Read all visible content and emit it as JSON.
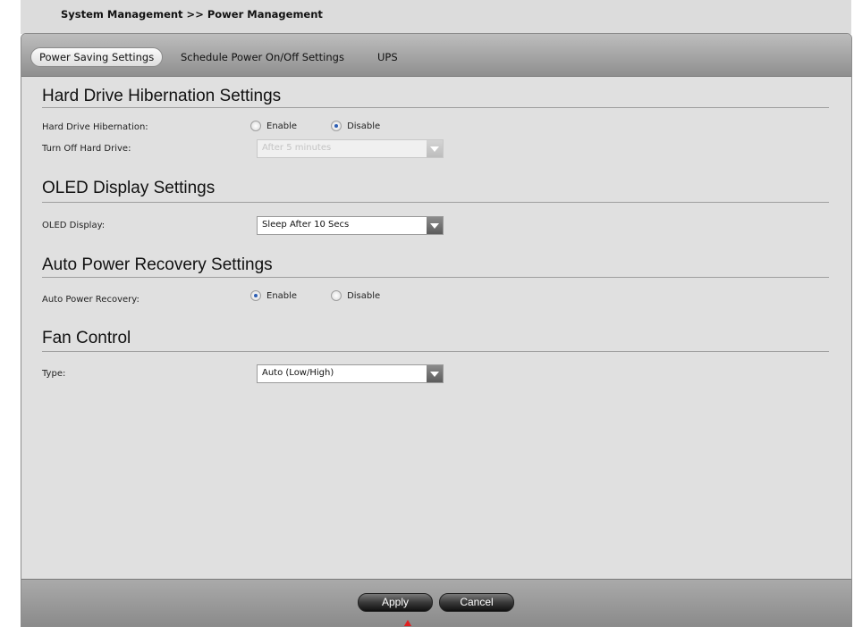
{
  "breadcrumb": "System Management >> Power Management",
  "tabs": [
    {
      "label": "Power Saving Settings",
      "active": true
    },
    {
      "label": "Schedule Power On/Off Settings",
      "active": false
    },
    {
      "label": "UPS",
      "active": false
    }
  ],
  "hibernation": {
    "title": "Hard Drive Hibernation Settings",
    "hibernation_label": "Hard Drive Hibernation:",
    "enable_label": "Enable",
    "disable_label": "Disable",
    "selected": "Disable",
    "turn_off_label": "Turn Off Hard Drive:",
    "turn_off_value": "After 5 minutes",
    "turn_off_disabled": true
  },
  "oled": {
    "title": "OLED Display Settings",
    "label": "OLED Display:",
    "value": "Sleep After 10 Secs"
  },
  "recovery": {
    "title": "Auto Power Recovery Settings",
    "label": "Auto Power Recovery:",
    "enable_label": "Enable",
    "disable_label": "Disable",
    "selected": "Enable"
  },
  "fan": {
    "title": "Fan Control",
    "label": "Type:",
    "value": "Auto (Low/High)"
  },
  "footer": {
    "apply_label": "Apply",
    "cancel_label": "Cancel"
  },
  "colors": {
    "pointer_arrow": "#e02020",
    "radio_checked": "#2b5db3"
  }
}
